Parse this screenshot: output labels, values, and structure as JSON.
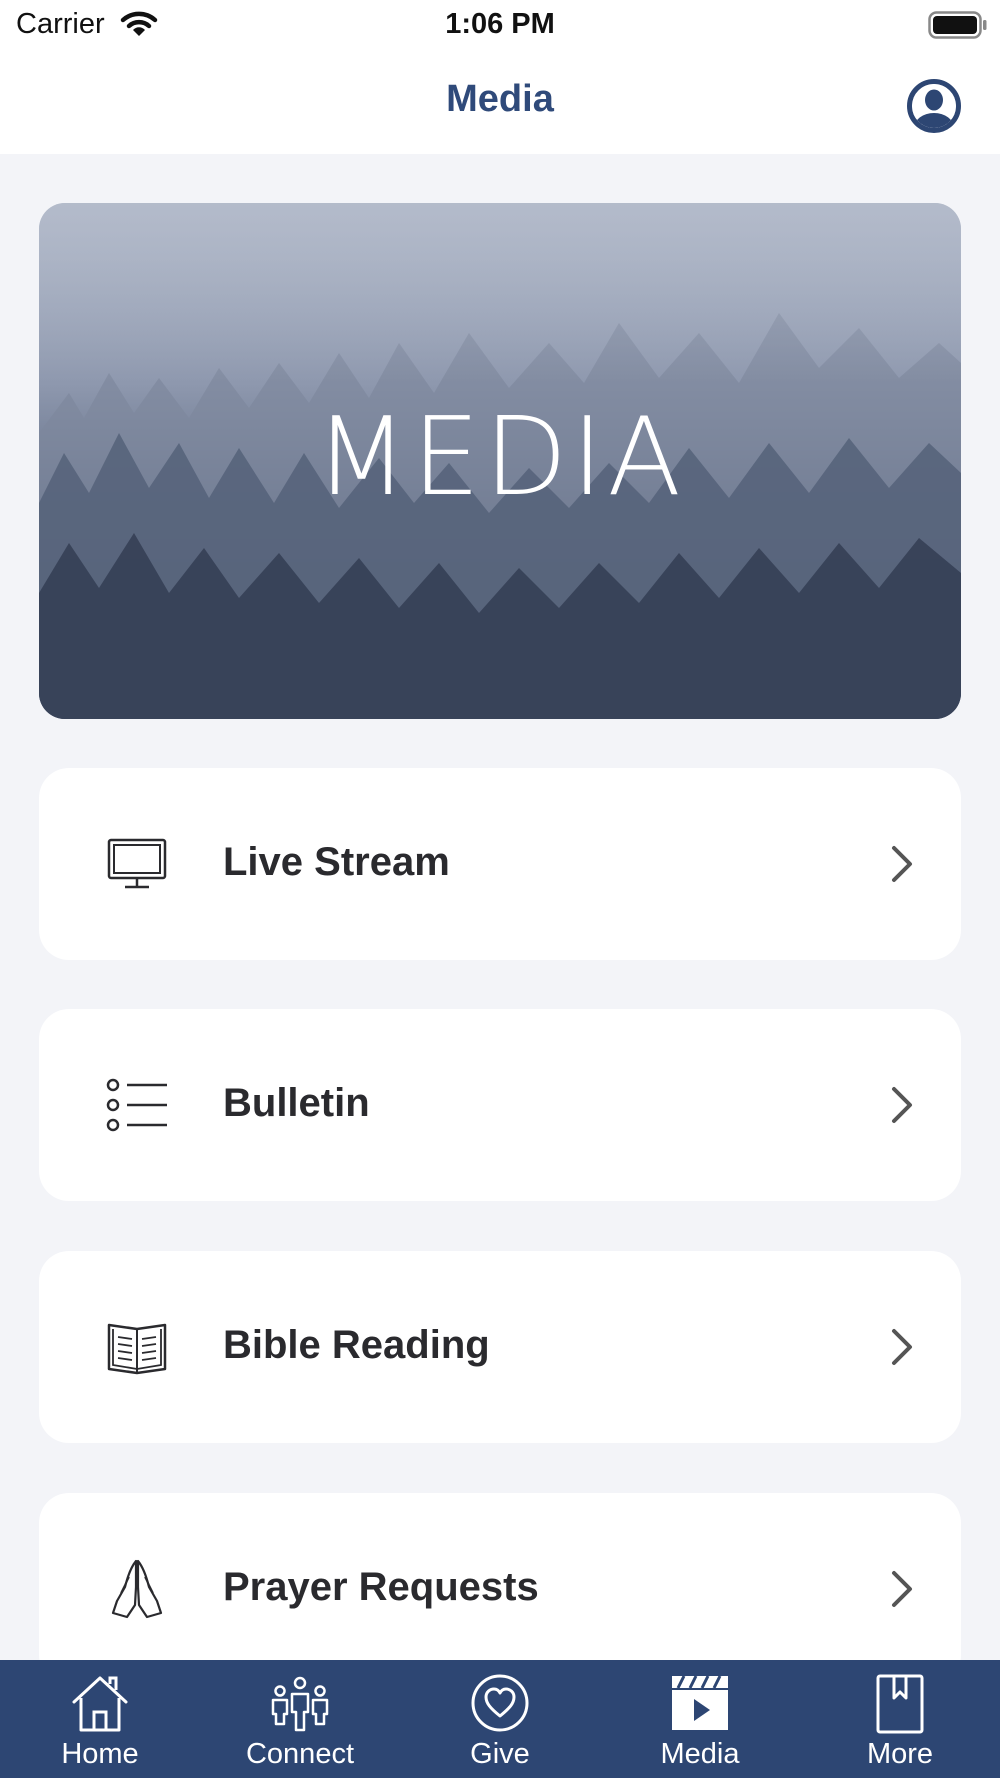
{
  "status_bar": {
    "carrier": "Carrier",
    "time": "1:06 PM"
  },
  "nav": {
    "title": "Media",
    "profile_icon": "user-circle-icon"
  },
  "banner": {
    "title": "MEDIA",
    "image": "misty-forest"
  },
  "menu": {
    "items": [
      {
        "label": "Live Stream",
        "icon": "monitor-icon"
      },
      {
        "label": "Bulletin",
        "icon": "list-icon"
      },
      {
        "label": "Bible Reading",
        "icon": "open-book-icon"
      },
      {
        "label": "Prayer Requests",
        "icon": "praying-hands-icon"
      }
    ]
  },
  "tab_bar": {
    "active": "Media",
    "tabs": [
      {
        "label": "Home",
        "icon": "house-icon"
      },
      {
        "label": "Connect",
        "icon": "people-icon"
      },
      {
        "label": "Give",
        "icon": "heart-circle-icon"
      },
      {
        "label": "Media",
        "icon": "clapperboard-play-icon"
      },
      {
        "label": "More",
        "icon": "bookmark-book-icon"
      }
    ]
  },
  "colors": {
    "brand": "#2d4673",
    "title": "#2f4a7a",
    "background": "#f3f4f8"
  }
}
